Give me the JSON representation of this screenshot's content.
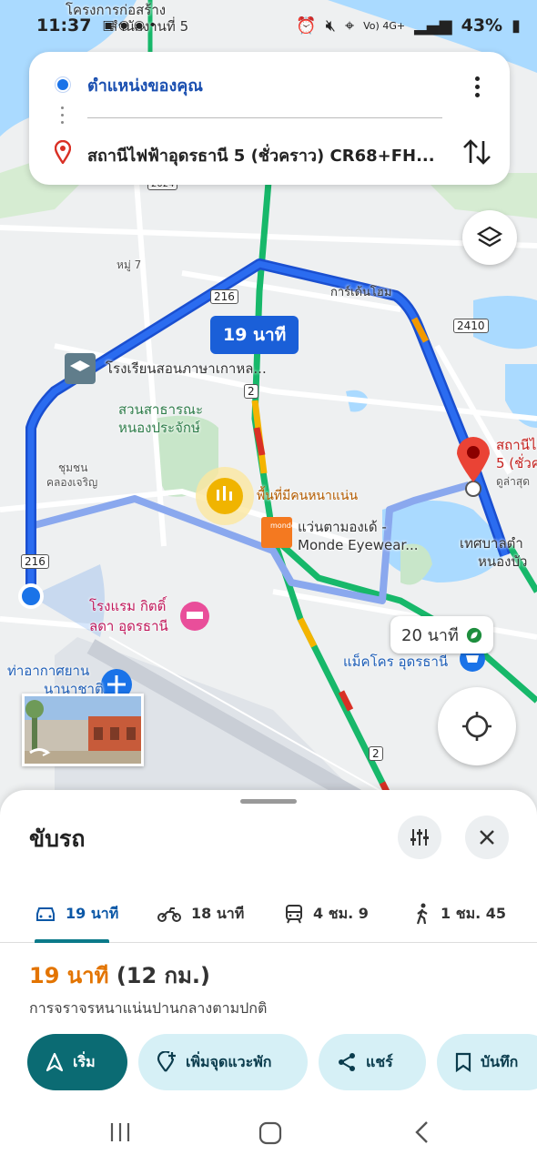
{
  "status": {
    "time": "11:37",
    "battery": "43%"
  },
  "search": {
    "origin": "ตำแหน่งของคุณ",
    "destination": "สถานีไฟฟ้าอุดรธานี 5 (ชั่วคราว) CR68+FH..."
  },
  "map": {
    "route_time": "19 นาที",
    "alt_route_time": "20 นาที",
    "labels": {
      "top_project": "โครงการก่อสร้าง",
      "top_project_sub": "สำนักงานที่ 5",
      "village": "หมู่ 7",
      "garden_home": "การ์เด้นโฮม",
      "school": "โรงเรียนสอนภาษาเกาหล...",
      "park_1": "สวนสาธารณะ",
      "park_2": "หนองประจักษ์",
      "community_1": "ชุมชน",
      "community_2": "คลองเจริญ",
      "crowded": "พื้นที่มีคนหนาแน่น",
      "shop_1": "แว่นตามองเด้ -",
      "shop_2": "Monde Eyewear...",
      "hotel_1": "โรงแรม กิตติ์",
      "hotel_2": "ลดา อุดรธานี",
      "airport_1": "ท่าอากาศยาน",
      "airport_2": "นานาชาติ",
      "makro": "แม็คโคร อุดรธานี",
      "dest_1": "สถานีไ",
      "dest_2": "5 (ชั่วค",
      "dest_3": "ดูล่าสุด",
      "muni_1": "เทศบาลตำ",
      "muni_2": "หนองบัว",
      "road_216a": "216",
      "road_216b": "216",
      "road_2410": "2410",
      "road_2a": "2",
      "road_2b": "2",
      "road_2024": "2024",
      "monde_logo": "monde"
    }
  },
  "sheet": {
    "title": "ขับรถ",
    "modes": [
      {
        "label": "19 นาที",
        "icon": "car-icon"
      },
      {
        "label": "18 นาที",
        "icon": "motorcycle-icon"
      },
      {
        "label": "4 ชม. 9",
        "icon": "train-icon"
      },
      {
        "label": "1 ชม. 45",
        "icon": "walk-icon"
      }
    ],
    "summary_duration": "19 นาที",
    "summary_distance": "(12 กม.)",
    "traffic_note": "การจราจรหนาแน่นปานกลางตามปกติ",
    "actions": {
      "start": "เริ่ม",
      "add_stop": "เพิ่มจุดแวะพัก",
      "share": "แชร์",
      "save": "บันทึก"
    }
  },
  "colors": {
    "route": "#1a5fd8",
    "alt_route": "#8aa8ee",
    "duration": "#e37400",
    "start_button": "#0b6b73"
  }
}
